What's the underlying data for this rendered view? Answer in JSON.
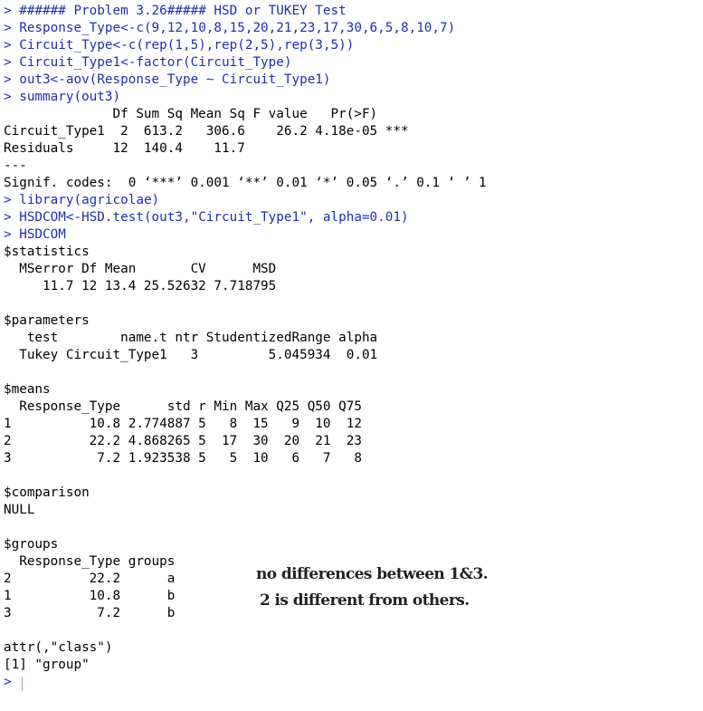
{
  "colors": {
    "command": "#1f2fa8",
    "output": "#000000",
    "background": "#ffffff"
  },
  "prompt": ">",
  "commands": [
    "###### Problem 3.26##### HSD or TUKEY Test",
    "Response_Type<-c(9,12,10,8,15,20,21,23,17,30,6,5,8,10,7)",
    "Circuit_Type<-c(rep(1,5),rep(2,5),rep(3,5))",
    "Circuit_Type1<-factor(Circuit_Type)",
    "out3<-aov(Response_Type ~ Circuit_Type1)",
    "summary(out3)",
    "library(agricolae)",
    "HSDCOM<-HSD.test(out3,\"Circuit_Type1\", alpha=0.01)",
    "HSDCOM"
  ],
  "anova": {
    "header": "              Df Sum Sq Mean Sq F value   Pr(>F)    ",
    "rows": [
      "Circuit_Type1  2  613.2   306.6    26.2 4.18e-05 ***",
      "Residuals     12  140.4    11.7                     "
    ],
    "separator": "---",
    "signif": "Signif. codes:  0 ‘***’ 0.001 ‘**’ 0.01 ‘*’ 0.05 ‘.’ 0.1 ‘ ’ 1"
  },
  "statistics": {
    "title": "$statistics",
    "header": "  MSerror Df Mean       CV      MSD",
    "row": "     11.7 12 13.4 25.52632 7.718795"
  },
  "parameters": {
    "title": "$parameters",
    "header": "   test        name.t ntr StudentizedRange alpha",
    "row": "  Tukey Circuit_Type1   3         5.045934  0.01"
  },
  "means": {
    "title": "$means",
    "header": "  Response_Type      std r Min Max Q25 Q50 Q75",
    "rows": [
      "1          10.8 2.774887 5   8  15   9  10  12",
      "2          22.2 4.868265 5  17  30  20  21  23",
      "3           7.2 1.923538 5   5  10   6   7   8"
    ]
  },
  "comparison": {
    "title": "$comparison",
    "value": "NULL"
  },
  "groups": {
    "title": "$groups",
    "header": "  Response_Type groups",
    "rows": [
      "2          22.2      a",
      "1          10.8      b",
      "3           7.2      b"
    ]
  },
  "attr": {
    "line1": "attr(,\"class\")",
    "line2": "[1] \"group\""
  },
  "annotations": [
    "no differences between 1&3.",
    "2 is different from others."
  ]
}
